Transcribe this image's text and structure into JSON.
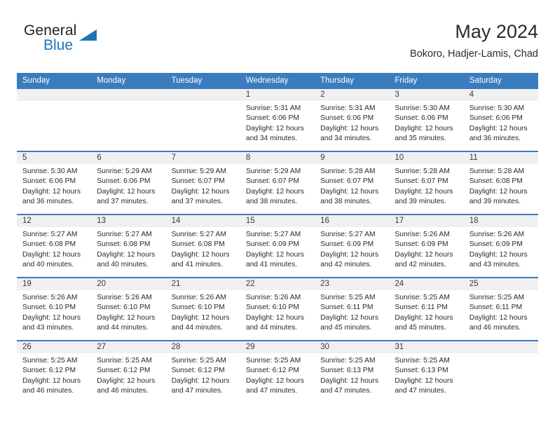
{
  "brand": {
    "word_one": "General",
    "word_two": "Blue",
    "triangle_color": "#1b75bb"
  },
  "header": {
    "title": "May 2024",
    "subtitle": "Bokoro, Hadjer-Lamis, Chad"
  },
  "theme": {
    "header_blue": "#3b7cbe",
    "daynum_gray": "#f0f0f0",
    "text_dark": "#2a2a2a"
  },
  "calendar": {
    "weekday_headers": [
      "Sunday",
      "Monday",
      "Tuesday",
      "Wednesday",
      "Thursday",
      "Friday",
      "Saturday"
    ],
    "labels": {
      "sunrise": "Sunrise:",
      "sunset": "Sunset:",
      "daylight": "Daylight:"
    },
    "weeks": [
      [
        {
          "day": "",
          "empty": true
        },
        {
          "day": "",
          "empty": true
        },
        {
          "day": "",
          "empty": true
        },
        {
          "day": "1",
          "sunrise": "Sunrise: 5:31 AM",
          "sunset": "Sunset: 6:06 PM",
          "daylight_1": "Daylight: 12 hours",
          "daylight_2": "and 34 minutes."
        },
        {
          "day": "2",
          "sunrise": "Sunrise: 5:31 AM",
          "sunset": "Sunset: 6:06 PM",
          "daylight_1": "Daylight: 12 hours",
          "daylight_2": "and 34 minutes."
        },
        {
          "day": "3",
          "sunrise": "Sunrise: 5:30 AM",
          "sunset": "Sunset: 6:06 PM",
          "daylight_1": "Daylight: 12 hours",
          "daylight_2": "and 35 minutes."
        },
        {
          "day": "4",
          "sunrise": "Sunrise: 5:30 AM",
          "sunset": "Sunset: 6:06 PM",
          "daylight_1": "Daylight: 12 hours",
          "daylight_2": "and 36 minutes."
        }
      ],
      [
        {
          "day": "5",
          "sunrise": "Sunrise: 5:30 AM",
          "sunset": "Sunset: 6:06 PM",
          "daylight_1": "Daylight: 12 hours",
          "daylight_2": "and 36 minutes."
        },
        {
          "day": "6",
          "sunrise": "Sunrise: 5:29 AM",
          "sunset": "Sunset: 6:06 PM",
          "daylight_1": "Daylight: 12 hours",
          "daylight_2": "and 37 minutes."
        },
        {
          "day": "7",
          "sunrise": "Sunrise: 5:29 AM",
          "sunset": "Sunset: 6:07 PM",
          "daylight_1": "Daylight: 12 hours",
          "daylight_2": "and 37 minutes."
        },
        {
          "day": "8",
          "sunrise": "Sunrise: 5:29 AM",
          "sunset": "Sunset: 6:07 PM",
          "daylight_1": "Daylight: 12 hours",
          "daylight_2": "and 38 minutes."
        },
        {
          "day": "9",
          "sunrise": "Sunrise: 5:28 AM",
          "sunset": "Sunset: 6:07 PM",
          "daylight_1": "Daylight: 12 hours",
          "daylight_2": "and 38 minutes."
        },
        {
          "day": "10",
          "sunrise": "Sunrise: 5:28 AM",
          "sunset": "Sunset: 6:07 PM",
          "daylight_1": "Daylight: 12 hours",
          "daylight_2": "and 39 minutes."
        },
        {
          "day": "11",
          "sunrise": "Sunrise: 5:28 AM",
          "sunset": "Sunset: 6:08 PM",
          "daylight_1": "Daylight: 12 hours",
          "daylight_2": "and 39 minutes."
        }
      ],
      [
        {
          "day": "12",
          "sunrise": "Sunrise: 5:27 AM",
          "sunset": "Sunset: 6:08 PM",
          "daylight_1": "Daylight: 12 hours",
          "daylight_2": "and 40 minutes."
        },
        {
          "day": "13",
          "sunrise": "Sunrise: 5:27 AM",
          "sunset": "Sunset: 6:08 PM",
          "daylight_1": "Daylight: 12 hours",
          "daylight_2": "and 40 minutes."
        },
        {
          "day": "14",
          "sunrise": "Sunrise: 5:27 AM",
          "sunset": "Sunset: 6:08 PM",
          "daylight_1": "Daylight: 12 hours",
          "daylight_2": "and 41 minutes."
        },
        {
          "day": "15",
          "sunrise": "Sunrise: 5:27 AM",
          "sunset": "Sunset: 6:09 PM",
          "daylight_1": "Daylight: 12 hours",
          "daylight_2": "and 41 minutes."
        },
        {
          "day": "16",
          "sunrise": "Sunrise: 5:27 AM",
          "sunset": "Sunset: 6:09 PM",
          "daylight_1": "Daylight: 12 hours",
          "daylight_2": "and 42 minutes."
        },
        {
          "day": "17",
          "sunrise": "Sunrise: 5:26 AM",
          "sunset": "Sunset: 6:09 PM",
          "daylight_1": "Daylight: 12 hours",
          "daylight_2": "and 42 minutes."
        },
        {
          "day": "18",
          "sunrise": "Sunrise: 5:26 AM",
          "sunset": "Sunset: 6:09 PM",
          "daylight_1": "Daylight: 12 hours",
          "daylight_2": "and 43 minutes."
        }
      ],
      [
        {
          "day": "19",
          "sunrise": "Sunrise: 5:26 AM",
          "sunset": "Sunset: 6:10 PM",
          "daylight_1": "Daylight: 12 hours",
          "daylight_2": "and 43 minutes."
        },
        {
          "day": "20",
          "sunrise": "Sunrise: 5:26 AM",
          "sunset": "Sunset: 6:10 PM",
          "daylight_1": "Daylight: 12 hours",
          "daylight_2": "and 44 minutes."
        },
        {
          "day": "21",
          "sunrise": "Sunrise: 5:26 AM",
          "sunset": "Sunset: 6:10 PM",
          "daylight_1": "Daylight: 12 hours",
          "daylight_2": "and 44 minutes."
        },
        {
          "day": "22",
          "sunrise": "Sunrise: 5:26 AM",
          "sunset": "Sunset: 6:10 PM",
          "daylight_1": "Daylight: 12 hours",
          "daylight_2": "and 44 minutes."
        },
        {
          "day": "23",
          "sunrise": "Sunrise: 5:25 AM",
          "sunset": "Sunset: 6:11 PM",
          "daylight_1": "Daylight: 12 hours",
          "daylight_2": "and 45 minutes."
        },
        {
          "day": "24",
          "sunrise": "Sunrise: 5:25 AM",
          "sunset": "Sunset: 6:11 PM",
          "daylight_1": "Daylight: 12 hours",
          "daylight_2": "and 45 minutes."
        },
        {
          "day": "25",
          "sunrise": "Sunrise: 5:25 AM",
          "sunset": "Sunset: 6:11 PM",
          "daylight_1": "Daylight: 12 hours",
          "daylight_2": "and 46 minutes."
        }
      ],
      [
        {
          "day": "26",
          "sunrise": "Sunrise: 5:25 AM",
          "sunset": "Sunset: 6:12 PM",
          "daylight_1": "Daylight: 12 hours",
          "daylight_2": "and 46 minutes."
        },
        {
          "day": "27",
          "sunrise": "Sunrise: 5:25 AM",
          "sunset": "Sunset: 6:12 PM",
          "daylight_1": "Daylight: 12 hours",
          "daylight_2": "and 46 minutes."
        },
        {
          "day": "28",
          "sunrise": "Sunrise: 5:25 AM",
          "sunset": "Sunset: 6:12 PM",
          "daylight_1": "Daylight: 12 hours",
          "daylight_2": "and 47 minutes."
        },
        {
          "day": "29",
          "sunrise": "Sunrise: 5:25 AM",
          "sunset": "Sunset: 6:12 PM",
          "daylight_1": "Daylight: 12 hours",
          "daylight_2": "and 47 minutes."
        },
        {
          "day": "30",
          "sunrise": "Sunrise: 5:25 AM",
          "sunset": "Sunset: 6:13 PM",
          "daylight_1": "Daylight: 12 hours",
          "daylight_2": "and 47 minutes."
        },
        {
          "day": "31",
          "sunrise": "Sunrise: 5:25 AM",
          "sunset": "Sunset: 6:13 PM",
          "daylight_1": "Daylight: 12 hours",
          "daylight_2": "and 47 minutes."
        },
        {
          "day": "",
          "empty": true
        }
      ]
    ]
  }
}
